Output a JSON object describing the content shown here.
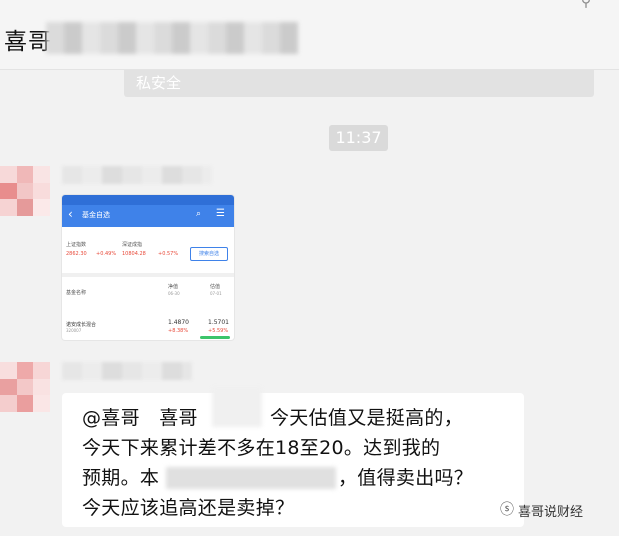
{
  "header": {
    "title": "喜哥",
    "pin_icon": "pin-icon"
  },
  "notice": {
    "text": "私安全"
  },
  "time": "11:37",
  "image_message": {
    "app_title": "基金自选",
    "indices": [
      {
        "name": "上证指数",
        "value": "2862.30",
        "change": "+0.49%"
      },
      {
        "name": "深证成指",
        "value": "10804.28",
        "change": "+0.57%"
      }
    ],
    "button": "搜索自选",
    "columns": [
      {
        "label": "基金名称",
        "sub": ""
      },
      {
        "label": "净值",
        "sub": "06-30"
      },
      {
        "label": "估值",
        "sub": "07-01"
      }
    ],
    "fund": {
      "name": "诺安成长混合",
      "code": "320007",
      "nav": "1.4870",
      "nav_change": "+8.38%",
      "estimate": "1.5701",
      "estimate_change": "+5.59%"
    }
  },
  "text_message": {
    "lines": [
      "@喜哥　喜哥",
      "今天估值又是挺高的，",
      "今天下来累计差不多在18至20。达到我的",
      "预期。本",
      "，值得卖出吗？",
      "今天应该追高还是卖掉？"
    ]
  },
  "watermark": {
    "icon": "wechat-channel-icon",
    "text": "喜哥说财经"
  },
  "colors": {
    "background": "#f2f2f2",
    "bubble": "#ffffff",
    "app_blue": "#3f82e9"
  }
}
